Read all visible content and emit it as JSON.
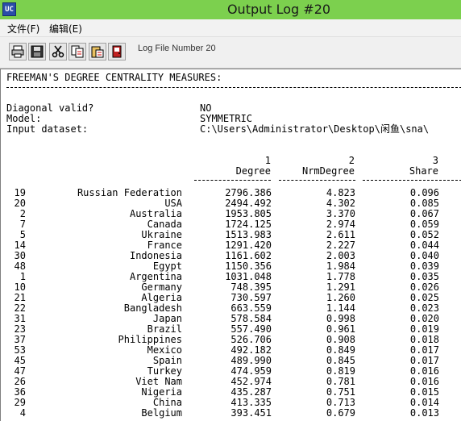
{
  "window": {
    "title": "Output Log #20",
    "icon_text": "UC"
  },
  "menu": {
    "file": "文件(F)",
    "edit": "编辑(E)"
  },
  "toolbar": {
    "log_label": "Log File Number 20"
  },
  "log": {
    "heading": "FREEMAN'S DEGREE CENTRALITY MEASURES:",
    "diag_label": "Diagonal valid?",
    "diag_value": "NO",
    "model_label": "Model:",
    "model_value": "SYMMETRIC",
    "input_label": "Input dataset:",
    "input_value": "C:\\Users\\Administrator\\Desktop\\闲鱼\\sna\\",
    "col_nums": [
      "1",
      "2",
      "3"
    ],
    "col_heads": [
      "Degree",
      "NrmDegree",
      "Share"
    ]
  },
  "table": [
    [
      "19",
      "Russian Federation",
      "2796.386",
      "4.823",
      "0.096"
    ],
    [
      "20",
      "USA",
      "2494.492",
      "4.302",
      "0.085"
    ],
    [
      "2",
      "Australia",
      "1953.805",
      "3.370",
      "0.067"
    ],
    [
      "7",
      "Canada",
      "1724.125",
      "2.974",
      "0.059"
    ],
    [
      "5",
      "Ukraine",
      "1513.983",
      "2.611",
      "0.052"
    ],
    [
      "14",
      "France",
      "1291.420",
      "2.227",
      "0.044"
    ],
    [
      "30",
      "Indonesia",
      "1161.602",
      "2.003",
      "0.040"
    ],
    [
      "48",
      "Egypt",
      "1150.356",
      "1.984",
      "0.039"
    ],
    [
      "1",
      "Argentina",
      "1031.048",
      "1.778",
      "0.035"
    ],
    [
      "10",
      "Germany",
      "748.395",
      "1.291",
      "0.026"
    ],
    [
      "21",
      "Algeria",
      "730.597",
      "1.260",
      "0.025"
    ],
    [
      "22",
      "Bangladesh",
      "663.559",
      "1.144",
      "0.023"
    ],
    [
      "31",
      "Japan",
      "578.584",
      "0.998",
      "0.020"
    ],
    [
      "23",
      "Brazil",
      "557.490",
      "0.961",
      "0.019"
    ],
    [
      "37",
      "Philippines",
      "526.706",
      "0.908",
      "0.018"
    ],
    [
      "53",
      "Mexico",
      "492.182",
      "0.849",
      "0.017"
    ],
    [
      "45",
      "Spain",
      "489.990",
      "0.845",
      "0.017"
    ],
    [
      "47",
      "Turkey",
      "474.959",
      "0.819",
      "0.016"
    ],
    [
      "26",
      "Viet Nam",
      "452.974",
      "0.781",
      "0.016"
    ],
    [
      "36",
      "Nigeria",
      "435.287",
      "0.751",
      "0.015"
    ],
    [
      "29",
      "China",
      "413.335",
      "0.713",
      "0.014"
    ],
    [
      "4",
      "Belgium",
      "393.451",
      "0.679",
      "0.013"
    ]
  ]
}
